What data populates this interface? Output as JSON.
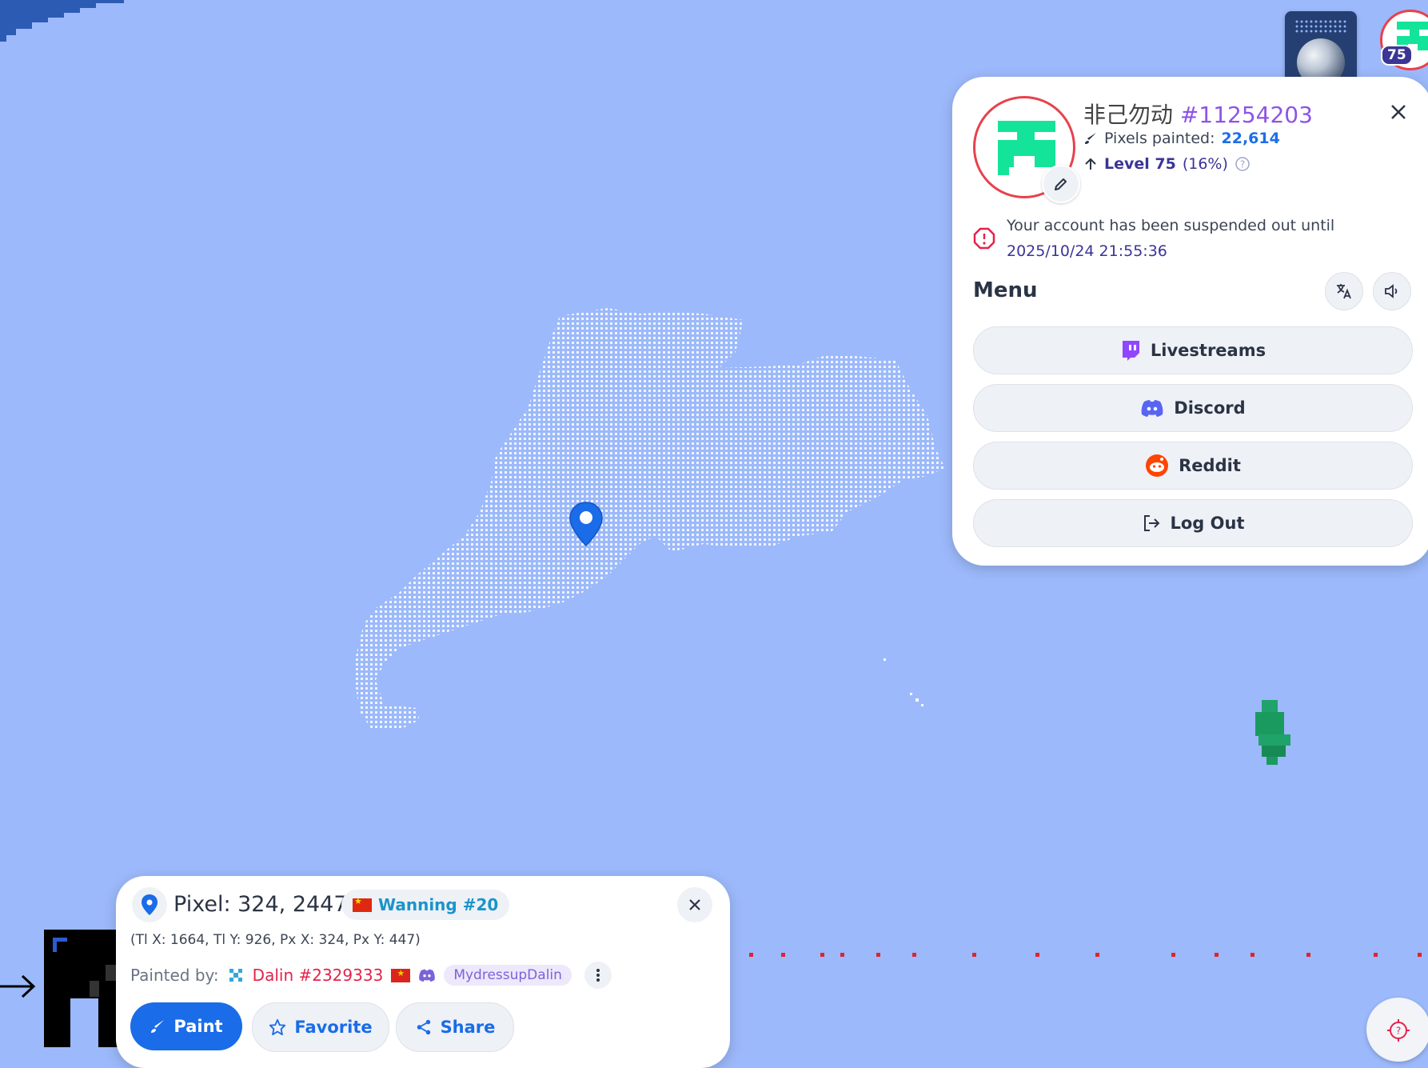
{
  "map": {
    "background_color": "#9cb9fb",
    "pin_color": "#1a6ce8"
  },
  "top_controls": {
    "globe_button_icon": "globe-icon",
    "avatar_level": "75"
  },
  "profile_panel": {
    "username": "非己勿动",
    "user_id": "#11254203",
    "pixels_label": "Pixels painted:",
    "pixels_value": "22,614",
    "level_label": "Level 75",
    "level_percent": "(16%)",
    "level_progress": 0.16,
    "warning_text": "Your account has been suspended out until",
    "warning_date": "2025/10/24 21:55:36",
    "menu_title": "Menu",
    "menu_items": [
      {
        "label": "Livestreams",
        "icon": "twitch-icon"
      },
      {
        "label": "Discord",
        "icon": "discord-icon"
      },
      {
        "label": "Reddit",
        "icon": "reddit-icon"
      },
      {
        "label": "Log Out",
        "icon": "logout-icon"
      }
    ],
    "accent_color": "#e8414c"
  },
  "pixel_panel": {
    "title": "Pixel: 324, 2447",
    "region": "Wanning #20",
    "coords": "(Tl X: 1664, Tl Y: 926, Px X: 324, Px Y: 447)",
    "painted_by_label": "Painted by:",
    "painter": "Dalin #2329333",
    "discord_name": "MydressupDalin",
    "buttons": {
      "paint": "Paint",
      "favorite": "Favorite",
      "share": "Share"
    }
  }
}
